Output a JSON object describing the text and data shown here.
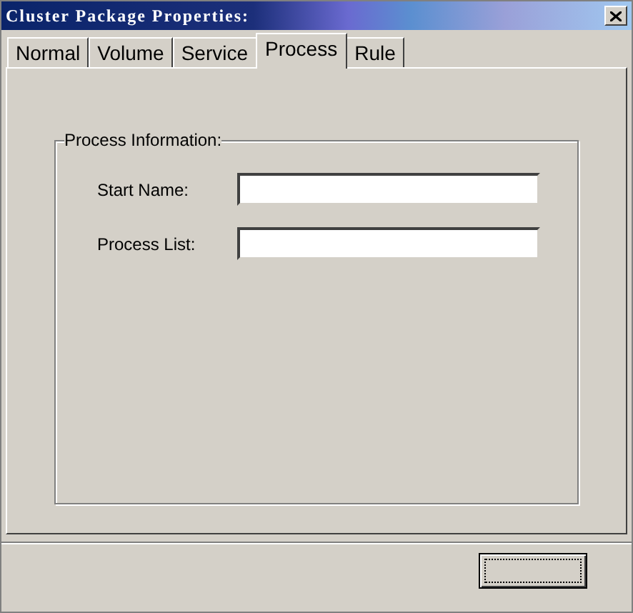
{
  "window": {
    "title": "Cluster Package Properties:"
  },
  "tabs": [
    {
      "label": "Normal",
      "selected": false
    },
    {
      "label": "Volume",
      "selected": false
    },
    {
      "label": "Service",
      "selected": false
    },
    {
      "label": "Process",
      "selected": true
    },
    {
      "label": "Rule",
      "selected": false
    }
  ],
  "group": {
    "title": "Process Information:",
    "fields": [
      {
        "label": "Start Name:"
      },
      {
        "label": "Process List:"
      }
    ]
  },
  "buttons": [
    {
      "focused": true
    }
  ]
}
